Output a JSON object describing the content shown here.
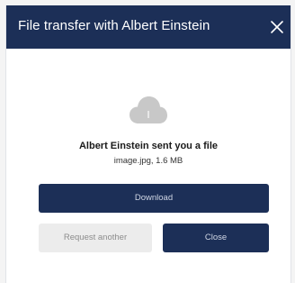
{
  "dialog": {
    "title": "File transfer with Albert Einstein",
    "close_icon": "close-icon"
  },
  "content": {
    "icon": "cloud-icon",
    "headline": "Albert Einstein sent you a file",
    "file_info": "image.jpg, 1.6 MB"
  },
  "actions": {
    "download_label": "Download",
    "request_another_label": "Request another",
    "close_label": "Close"
  },
  "colors": {
    "header_bg": "#1c2f57",
    "primary_button": "#1c2f57",
    "disabled_button": "#ececec",
    "cloud_icon": "#c8c8c8"
  }
}
